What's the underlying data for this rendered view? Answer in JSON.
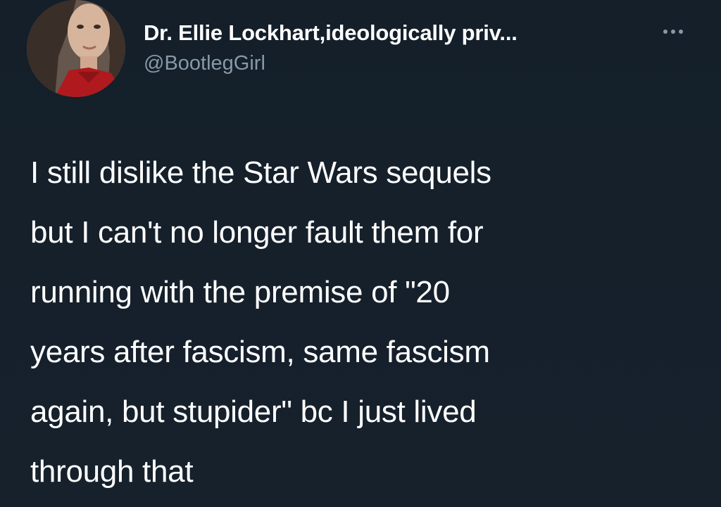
{
  "tweet": {
    "author": {
      "display_name": "Dr. Ellie Lockhart,ideologically priv...",
      "handle": "@BootlegGirl"
    },
    "more_icon": "more-horizontal-icon",
    "text_lines": [
      "I still dislike the Star Wars sequels",
      "but I can't no longer fault them for",
      "running with the premise of \"20",
      "years after fascism, same fascism",
      "again, but stupider\" bc I just lived",
      "through that"
    ]
  },
  "colors": {
    "background": "#15202b",
    "text_primary": "#ffffff",
    "text_secondary": "#8899a6"
  }
}
